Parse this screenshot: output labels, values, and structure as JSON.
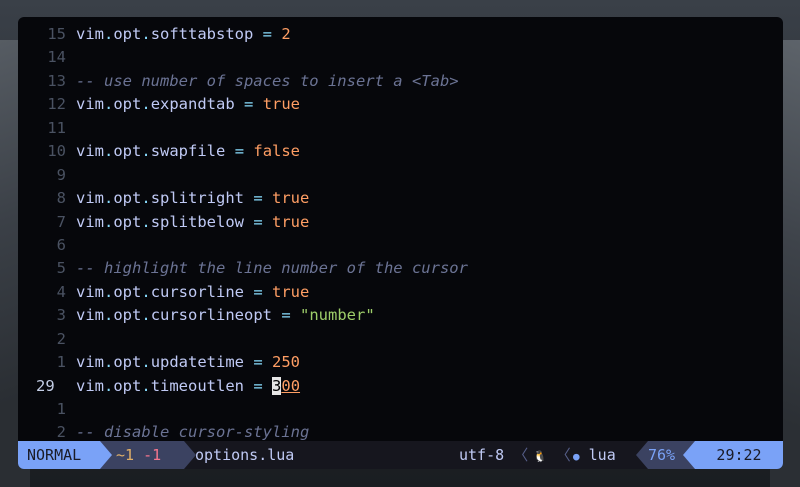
{
  "editor": {
    "lines": [
      {
        "n": "15",
        "parts": [
          [
            "id",
            "vim"
          ],
          [
            "dot",
            "."
          ],
          [
            "id",
            "opt"
          ],
          [
            "dot",
            "."
          ],
          [
            "id",
            "softtabstop "
          ],
          [
            "op",
            "= "
          ],
          [
            "num",
            "2"
          ]
        ]
      },
      {
        "n": "14",
        "parts": []
      },
      {
        "n": "13",
        "parts": [
          [
            "cmt",
            "-- use number of spaces to insert a <Tab>"
          ]
        ]
      },
      {
        "n": "12",
        "parts": [
          [
            "id",
            "vim"
          ],
          [
            "dot",
            "."
          ],
          [
            "id",
            "opt"
          ],
          [
            "dot",
            "."
          ],
          [
            "id",
            "expandtab "
          ],
          [
            "op",
            "= "
          ],
          [
            "bool",
            "true"
          ]
        ]
      },
      {
        "n": "11",
        "parts": []
      },
      {
        "n": "10",
        "parts": [
          [
            "id",
            "vim"
          ],
          [
            "dot",
            "."
          ],
          [
            "id",
            "opt"
          ],
          [
            "dot",
            "."
          ],
          [
            "id",
            "swapfile "
          ],
          [
            "op",
            "= "
          ],
          [
            "bool",
            "false"
          ]
        ]
      },
      {
        "n": "9",
        "parts": []
      },
      {
        "n": "8",
        "parts": [
          [
            "id",
            "vim"
          ],
          [
            "dot",
            "."
          ],
          [
            "id",
            "opt"
          ],
          [
            "dot",
            "."
          ],
          [
            "id",
            "splitright "
          ],
          [
            "op",
            "= "
          ],
          [
            "bool",
            "true"
          ]
        ]
      },
      {
        "n": "7",
        "parts": [
          [
            "id",
            "vim"
          ],
          [
            "dot",
            "."
          ],
          [
            "id",
            "opt"
          ],
          [
            "dot",
            "."
          ],
          [
            "id",
            "splitbelow "
          ],
          [
            "op",
            "= "
          ],
          [
            "bool",
            "true"
          ]
        ]
      },
      {
        "n": "6",
        "parts": []
      },
      {
        "n": "5",
        "parts": [
          [
            "cmt",
            "-- highlight the line number of the cursor"
          ]
        ]
      },
      {
        "n": "4",
        "parts": [
          [
            "id",
            "vim"
          ],
          [
            "dot",
            "."
          ],
          [
            "id",
            "opt"
          ],
          [
            "dot",
            "."
          ],
          [
            "id",
            "cursorline "
          ],
          [
            "op",
            "= "
          ],
          [
            "bool",
            "true"
          ]
        ]
      },
      {
        "n": "3",
        "parts": [
          [
            "id",
            "vim"
          ],
          [
            "dot",
            "."
          ],
          [
            "id",
            "opt"
          ],
          [
            "dot",
            "."
          ],
          [
            "id",
            "cursorlineopt "
          ],
          [
            "op",
            "= "
          ],
          [
            "str",
            "\"number\""
          ]
        ]
      },
      {
        "n": "2",
        "parts": []
      },
      {
        "n": "1",
        "parts": [
          [
            "id",
            "vim"
          ],
          [
            "dot",
            "."
          ],
          [
            "id",
            "opt"
          ],
          [
            "dot",
            "."
          ],
          [
            "id",
            "updatetime "
          ],
          [
            "op",
            "= "
          ],
          [
            "num",
            "250"
          ]
        ]
      },
      {
        "n": "29",
        "current": true,
        "parts": [
          [
            "id",
            "vim"
          ],
          [
            "dot",
            "."
          ],
          [
            "id",
            "opt"
          ],
          [
            "dot",
            "."
          ],
          [
            "id",
            "timeoutlen "
          ],
          [
            "op",
            "= "
          ],
          [
            "cursor",
            "3"
          ],
          [
            "num-ul",
            "00"
          ]
        ]
      },
      {
        "n": "1",
        "parts": []
      },
      {
        "n": "2",
        "parts": [
          [
            "cmt",
            "-- disable cursor-styling"
          ]
        ]
      }
    ]
  },
  "statusline": {
    "mode": "NORMAL",
    "diff_added": "~1",
    "diff_removed": "-1",
    "filename": "options.lua",
    "encoding": "utf-8",
    "separator": "〈",
    "os_icon": "🐧",
    "filetype_icon": "●",
    "filetype": "lua",
    "percent": "76%",
    "position": "29:22"
  },
  "colors": {
    "accent": "#7aa2f7",
    "secondary": "#3b4261",
    "number": "#ff9e64",
    "string": "#9ece6a",
    "comment": "#6b7394"
  }
}
